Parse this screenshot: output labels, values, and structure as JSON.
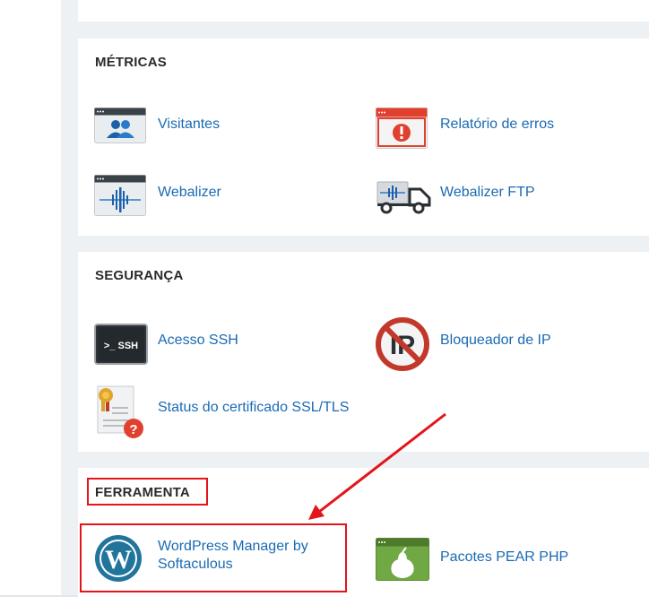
{
  "sections": {
    "metricas": {
      "title": "MÉTRICAS",
      "items": [
        {
          "label": "Visitantes",
          "icon": "visitors-icon"
        },
        {
          "label": "Relatório de erros",
          "icon": "error-report-icon"
        },
        {
          "label": "Webalizer",
          "icon": "webalizer-icon"
        },
        {
          "label": "Webalizer FTP",
          "icon": "webalizer-ftp-icon"
        }
      ]
    },
    "seguranca": {
      "title": "SEGURANÇA",
      "items": [
        {
          "label": "Acesso SSH",
          "icon": "ssh-icon",
          "icon_text": ">_ SSH"
        },
        {
          "label": "Bloqueador de IP",
          "icon": "ip-blocker-icon",
          "icon_text": "IP"
        },
        {
          "label": "Status do certificado SSL/TLS",
          "icon": "ssl-certificate-icon"
        }
      ]
    },
    "ferramenta": {
      "title": "FERRAMENTA",
      "items": [
        {
          "label_line1": "WordPress Manager by",
          "label_line2": "Softaculous",
          "icon": "wordpress-icon"
        },
        {
          "label": "Pacotes PEAR PHP",
          "icon": "pear-icon"
        }
      ]
    }
  },
  "colors": {
    "link": "#1a6ab3",
    "highlight": "#e3141a",
    "background": "#eef1f4"
  }
}
